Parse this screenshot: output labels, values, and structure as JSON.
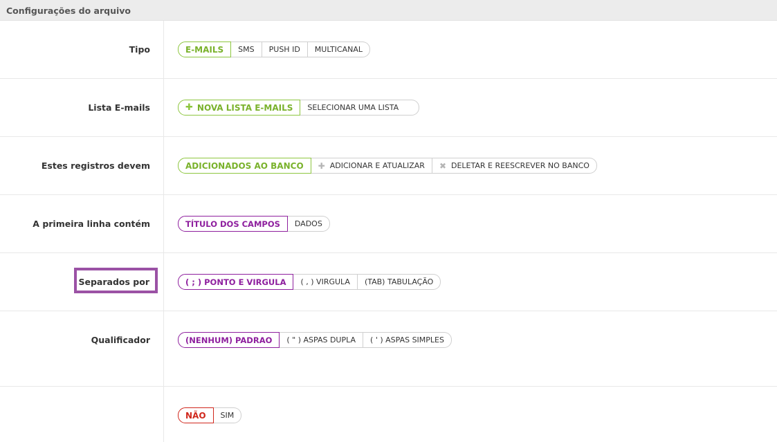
{
  "header": {
    "title": "Configurações do arquivo"
  },
  "rows": {
    "tipo": {
      "label": "Tipo",
      "options": [
        "E-MAILS",
        "SMS",
        "PUSH ID",
        "MULTICANAL"
      ]
    },
    "lista": {
      "label": "Lista E-mails",
      "options": [
        "NOVA LISTA E-MAILS",
        "SELECIONAR UMA LISTA"
      ]
    },
    "registros": {
      "label": "Estes registros devem",
      "options": [
        "ADICIONADOS AO BANCO",
        "ADICIONAR E ATUALIZAR",
        "DELETAR E REESCREVER NO BANCO"
      ]
    },
    "primeira": {
      "label": "A primeira linha contém",
      "options": [
        "TÍTULO DOS CAMPOS",
        "DADOS"
      ]
    },
    "separados": {
      "label": "Separados por",
      "options": [
        "( ; ) PONTO E VIRGULA",
        "( , ) VIRGULA",
        "(TAB) TABULAÇÃO"
      ]
    },
    "qualificador": {
      "label": "Qualificador",
      "options": [
        "(NENHUM) PADRAO",
        "( \" ) ASPAS DUPLA",
        "( ' ) ASPAS SIMPLES"
      ]
    },
    "ultima": {
      "label": "",
      "options": [
        "NÃO",
        "SIM"
      ]
    }
  },
  "colors": {
    "green": "#8dc63f",
    "purple": "#8e1f9e",
    "red": "#d0271c",
    "highlight": "#9b52a5"
  },
  "icons": {
    "add": "plus-icon",
    "close": "x-icon"
  }
}
